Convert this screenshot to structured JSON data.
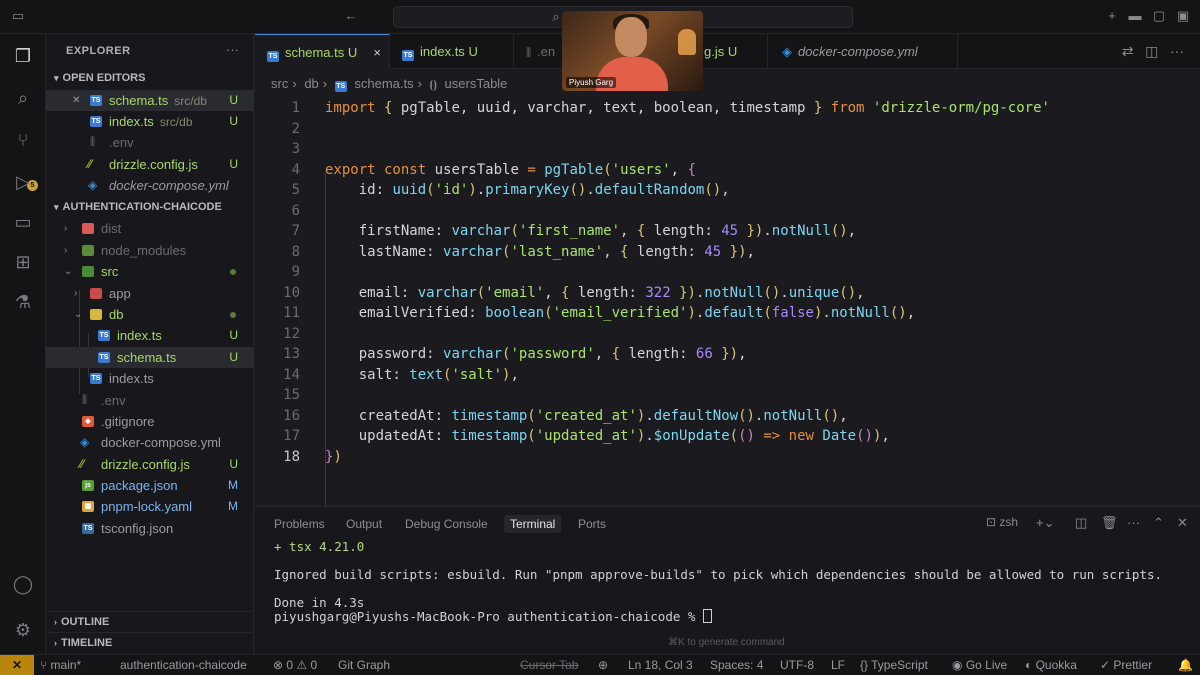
{
  "titlebar": {
    "back_icon": "arrow-left",
    "search_icon": "search"
  },
  "activity": [
    "files-icon",
    "search-icon",
    "source-control-icon",
    "run-debug-icon",
    "remote-explorer-icon",
    "extensions-icon",
    "testing-icon",
    "account-icon",
    "settings-icon"
  ],
  "activity_badge": "5",
  "explorer": {
    "title": "EXPLORER",
    "more": "···",
    "open_editors_title": "OPEN EDITORS",
    "open_editors": [
      {
        "name": "schema.ts",
        "sub": "src/db",
        "status": "U"
      },
      {
        "name": "index.ts",
        "sub": "src/db",
        "status": "U"
      },
      {
        "name": ".env",
        "sub": "",
        "status": ""
      },
      {
        "name": "drizzle.config.js",
        "sub": "",
        "status": "U"
      },
      {
        "name": "docker-compose.yml",
        "sub": "",
        "status": ""
      }
    ],
    "project_title": "AUTHENTICATION-CHAICODE",
    "tree": [
      {
        "name": "dist",
        "status": ""
      },
      {
        "name": "node_modules",
        "status": ""
      },
      {
        "name": "src",
        "status": ""
      },
      {
        "name": "app",
        "status": ""
      },
      {
        "name": "db",
        "status": ""
      },
      {
        "name": "index.ts",
        "status": "U"
      },
      {
        "name": "schema.ts",
        "status": "U"
      },
      {
        "name": "index.ts",
        "status": ""
      },
      {
        "name": ".env",
        "status": ""
      },
      {
        "name": ".gitignore",
        "status": ""
      },
      {
        "name": "docker-compose.yml",
        "status": ""
      },
      {
        "name": "drizzle.config.js",
        "status": "U"
      },
      {
        "name": "package.json",
        "status": "M"
      },
      {
        "name": "pnpm-lock.yaml",
        "status": "M"
      },
      {
        "name": "tsconfig.json",
        "status": ""
      }
    ],
    "outline": "OUTLINE",
    "timeline": "TIMELINE"
  },
  "tabs": [
    {
      "label": "schema.ts",
      "status": "U",
      "close": "×"
    },
    {
      "label": "index.ts",
      "status": "U"
    },
    {
      "label": ".en",
      "status": ""
    },
    {
      "label": "g.js",
      "status": "U"
    },
    {
      "label": "docker-compose.yml",
      "status": ""
    }
  ],
  "breadcrumb": [
    "src",
    "db",
    "schema.ts",
    "usersTable"
  ],
  "webcam": {
    "label": "Piyush Garg"
  },
  "code": {
    "lines": [
      "1",
      "2",
      "3",
      "4",
      "5",
      "6",
      "7",
      "8",
      "9",
      "10",
      "11",
      "12",
      "13",
      "14",
      "15",
      "16",
      "17",
      "18"
    ]
  },
  "panel": {
    "tabs": [
      "Problems",
      "Output",
      "Debug Console",
      "Terminal",
      "Ports"
    ],
    "shell": "zsh",
    "terminal": [
      "+ tsx 4.21.0",
      "",
      "Ignored build scripts: esbuild. Run \"pnpm approve-builds\" to pick which dependencies should be allowed to run scripts.",
      "",
      "Done in 4.3s",
      "piyushgarg@Piyushs-MacBook-Pro authentication-chaicode % "
    ],
    "hint": "⌘K to generate command"
  },
  "statusbar": {
    "remote": "✕",
    "branch": "main*",
    "project": "authentication-chaicode",
    "problems": "⊗ 0 ⚠ 0",
    "git_graph": "Git Graph",
    "cursor_tab": "Cursor Tab",
    "position": "Ln 18, Col 3",
    "spaces": "Spaces: 4",
    "encoding": "UTF-8",
    "eol": "LF",
    "language": "TypeScript",
    "golive": "Go Live",
    "quokka": "Quokka",
    "prettier": "Prettier"
  }
}
